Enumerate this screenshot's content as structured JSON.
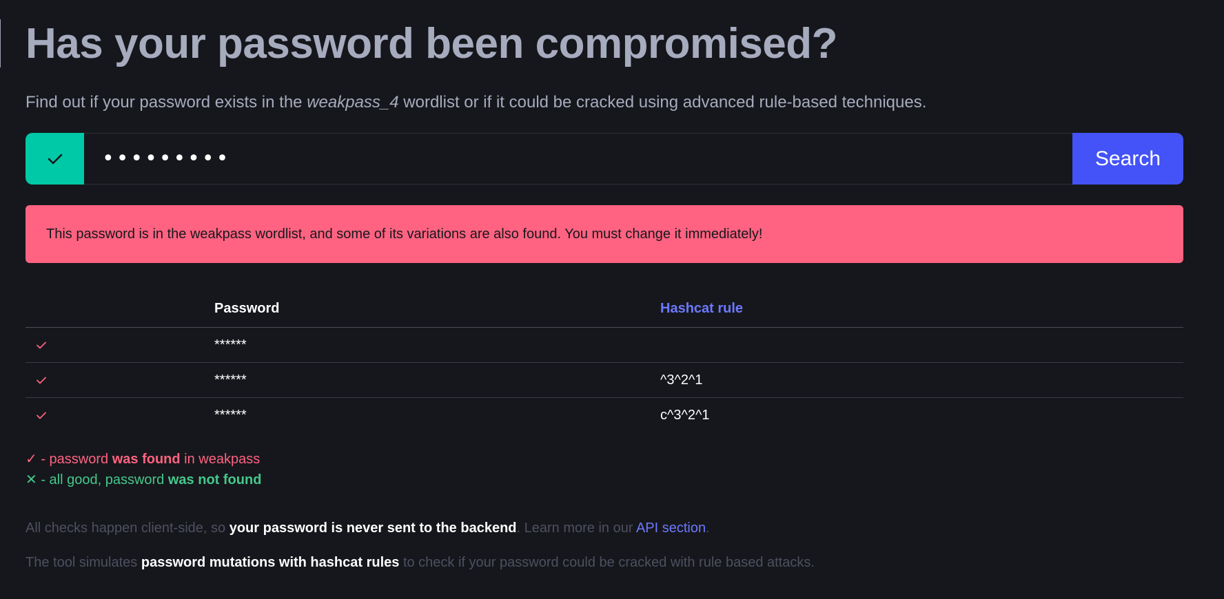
{
  "title": "Has your password been compromised?",
  "subtitle": {
    "before": "Find out if your password exists in the ",
    "emphasis": "weakpass_4",
    "after": " wordlist or if it could be cracked using advanced rule-based techniques."
  },
  "search": {
    "status_icon": "check-icon",
    "status_color": "#00c9a7",
    "input_value": "passwords",
    "button_label": "Search",
    "button_color": "#4353f7"
  },
  "alert": {
    "text": "This password is in the weakpass wordlist, and some of its variations are also found. You must change it immediately!",
    "color": "#ff6381"
  },
  "table": {
    "headers": [
      "",
      "Password",
      "Hashcat rule"
    ],
    "rows": [
      {
        "icon": "check-icon",
        "password": "******",
        "rule": ""
      },
      {
        "icon": "check-icon",
        "password": "******",
        "rule": "^3^2^1"
      },
      {
        "icon": "check-icon",
        "password": "******",
        "rule": "c^3^2^1"
      }
    ]
  },
  "legend": {
    "found": {
      "symbol": "✓",
      "prefix": " - password ",
      "bold": "was found",
      "suffix": " in weakpass"
    },
    "not_found": {
      "symbol": "✕",
      "prefix": " - all good, password ",
      "bold": "was not found"
    }
  },
  "notes": {
    "line1": {
      "a": "All checks happen client-side, so ",
      "b": "your password is never sent to the backend",
      "c": ". Learn more in our ",
      "link": "API section",
      "d": "."
    },
    "line2": {
      "a": "The tool simulates ",
      "b": "password mutations with hashcat rules",
      "c": " to check if your password could be cracked with rule based attacks."
    }
  }
}
